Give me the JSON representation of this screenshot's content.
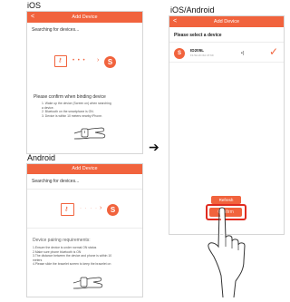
{
  "labels": {
    "ios": "iOS",
    "android": "Android",
    "ios_android": "iOS/Android"
  },
  "ios_screen": {
    "title": "Add Device",
    "back": "<",
    "searching": "Searching for devices...",
    "instructions_title": "Please confirm when binding device",
    "instructions": [
      "1. Wake up the device (Screen on) when searching",
      "a device.",
      "2. Bluetooth on the smartphone is ON.",
      "3. Device is within 10 meters nearby iPhone."
    ]
  },
  "android_screen": {
    "title": "Add Device",
    "searching": "Searching for devices...",
    "requirements_title": "Device pairing requirements:",
    "requirements": [
      "1.Ensure the device is under normal ON status",
      "2.Make sure phone bluetooth is ON",
      "3.The distance between the device and phone is within 10",
      "meters",
      "4.Please slide the bracelet screen to keep the bracelet on"
    ]
  },
  "select_screen": {
    "title": "Add Device",
    "back": "<",
    "select_label": "Please select a device",
    "device_name": "ID205L",
    "device_id": "F1:5A:2C:6A:47:69",
    "refresh_label": "Refresh",
    "confirm_label": "Confirm"
  },
  "colors": {
    "accent": "#f1633d",
    "highlight": "#e02b20"
  },
  "icons": {
    "phone": "phone-key-icon",
    "dots": "ellipsis-icon",
    "chevron": "chevron-right-icon",
    "brand": "s-logo-icon",
    "watch": "watch-hand-icon",
    "arrow": "right-arrow-icon",
    "signal": "signal-icon",
    "check": "checkmark-icon",
    "hand": "pointing-hand-icon"
  }
}
